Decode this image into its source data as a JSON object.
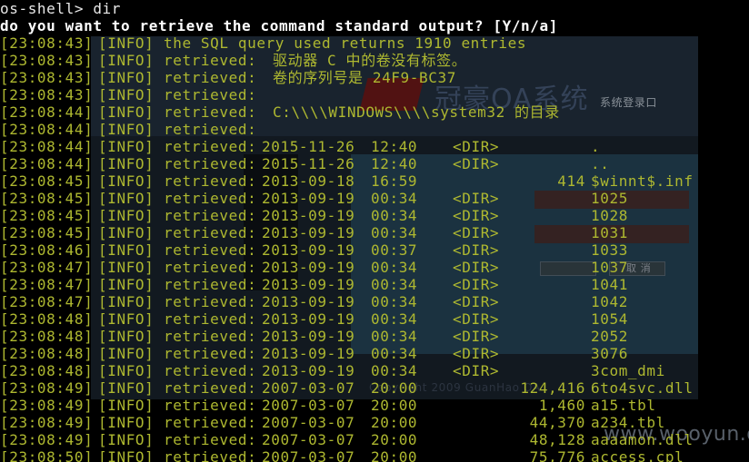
{
  "colors": {
    "background": "#000000",
    "log_text": "#aeb830",
    "command_text": "#e8e8e8",
    "question_text": "#ffffff"
  },
  "terminal": {
    "prompt": "os-shell> dir",
    "question": "do you want to retrieve the command standard output? [Y/n/a]",
    "info_tag": "[INFO]",
    "retrieved_label": "retrieved:",
    "lines": [
      {
        "time": "[23:08:43]",
        "message": "the SQL query used returns 1910 entries"
      },
      {
        "time": "[23:08:43]",
        "text": "驱动器 C 中的卷没有标签。"
      },
      {
        "time": "[23:08:43]",
        "text": "卷的序列号是 24F9-BC37"
      },
      {
        "time": "[23:08:43]",
        "text": ""
      },
      {
        "time": "[23:08:44]",
        "text": "C:\\\\\\\\WINDOWS\\\\\\\\system32 的目录"
      },
      {
        "time": "[23:08:44]",
        "text": ""
      },
      {
        "time": "[23:08:44]",
        "date": "2015-11-26",
        "clock": "12:40",
        "dir": "<DIR>",
        "size": "",
        "name": "."
      },
      {
        "time": "[23:08:44]",
        "date": "2015-11-26",
        "clock": "12:40",
        "dir": "<DIR>",
        "size": "",
        "name": ".."
      },
      {
        "time": "[23:08:45]",
        "date": "2013-09-18",
        "clock": "16:59",
        "dir": "",
        "size": "414",
        "name": "$winnt$.inf"
      },
      {
        "time": "[23:08:45]",
        "date": "2013-09-19",
        "clock": "00:34",
        "dir": "<DIR>",
        "size": "",
        "name": "1025"
      },
      {
        "time": "[23:08:45]",
        "date": "2013-09-19",
        "clock": "00:34",
        "dir": "<DIR>",
        "size": "",
        "name": "1028"
      },
      {
        "time": "[23:08:45]",
        "date": "2013-09-19",
        "clock": "00:34",
        "dir": "<DIR>",
        "size": "",
        "name": "1031"
      },
      {
        "time": "[23:08:46]",
        "date": "2013-09-19",
        "clock": "00:37",
        "dir": "<DIR>",
        "size": "",
        "name": "1033"
      },
      {
        "time": "[23:08:47]",
        "date": "2013-09-19",
        "clock": "00:34",
        "dir": "<DIR>",
        "size": "",
        "name": "1037"
      },
      {
        "time": "[23:08:47]",
        "date": "2013-09-19",
        "clock": "00:34",
        "dir": "<DIR>",
        "size": "",
        "name": "1041"
      },
      {
        "time": "[23:08:47]",
        "date": "2013-09-19",
        "clock": "00:34",
        "dir": "<DIR>",
        "size": "",
        "name": "1042"
      },
      {
        "time": "[23:08:48]",
        "date": "2013-09-19",
        "clock": "00:34",
        "dir": "<DIR>",
        "size": "",
        "name": "1054"
      },
      {
        "time": "[23:08:48]",
        "date": "2013-09-19",
        "clock": "00:34",
        "dir": "<DIR>",
        "size": "",
        "name": "2052"
      },
      {
        "time": "[23:08:48]",
        "date": "2013-09-19",
        "clock": "00:34",
        "dir": "<DIR>",
        "size": "",
        "name": "3076"
      },
      {
        "time": "[23:08:48]",
        "date": "2013-09-19",
        "clock": "00:34",
        "dir": "<DIR>",
        "size": "",
        "name": "3com_dmi"
      },
      {
        "time": "[23:08:49]",
        "date": "2007-03-07",
        "clock": "20:00",
        "dir": "",
        "size": "124,416",
        "name": "6to4svc.dll"
      },
      {
        "time": "[23:08:49]",
        "date": "2007-03-07",
        "clock": "20:00",
        "dir": "",
        "size": "1,460",
        "name": "a15.tbl"
      },
      {
        "time": "[23:08:49]",
        "date": "2007-03-07",
        "clock": "20:00",
        "dir": "",
        "size": "44,370",
        "name": "a234.tbl"
      },
      {
        "time": "[23:08:49]",
        "date": "2007-03-07",
        "clock": "20:00",
        "dir": "",
        "size": "48,128",
        "name": "aaaamon.dll"
      },
      {
        "time": "[23:08:50]",
        "date": "2007-03-07",
        "clock": "20:00",
        "dir": "",
        "size": "75,776",
        "name": "access.cpl"
      }
    ]
  },
  "background_window": {
    "title": "冠豪OA系统",
    "subtitle": "系统登录口",
    "cancel_label": "取 消",
    "copyright": "Copyright 2009 GuanHao OA"
  },
  "watermark": "www.wooyun.org"
}
